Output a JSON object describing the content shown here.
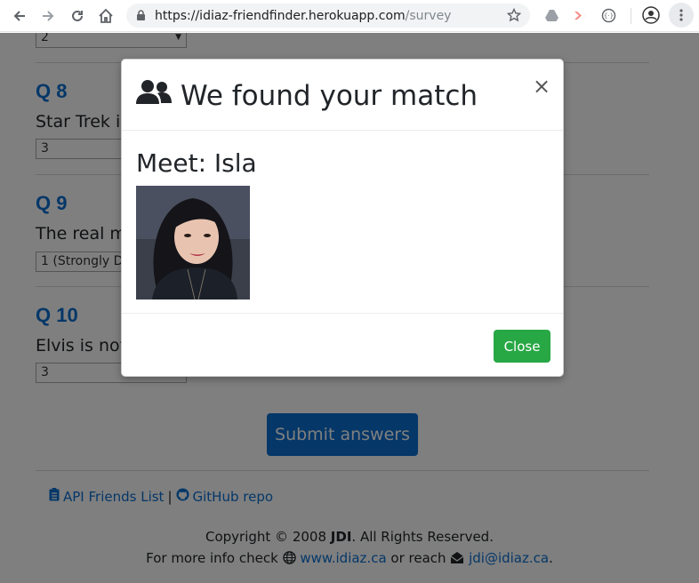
{
  "browser": {
    "url_host": "https://idiaz-friendfinder.herokuapp.com",
    "url_path": "/survey"
  },
  "survey": {
    "prev_select_value": "2",
    "questions": [
      {
        "label": "Q 8",
        "text": "Star Trek is",
        "value": "3"
      },
      {
        "label": "Q 9",
        "text": "The real m",
        "value": "1 (Strongly D"
      },
      {
        "label": "Q 10",
        "text": "Elvis is not",
        "value": "3"
      }
    ],
    "submit_label": "Submit answers"
  },
  "footer": {
    "api_link": "API Friends List",
    "separator": "|",
    "github_link": "GitHub repo",
    "copyright_prefix": "Copyright © 2008 ",
    "copyright_owner": "JDI",
    "copyright_suffix": ". All Rights Reserved.",
    "info_prefix": "For more info check ",
    "website": "www.idiaz.ca",
    "info_middle": " or reach ",
    "email": "jdi@idiaz.ca",
    "info_suffix": "."
  },
  "modal": {
    "title": "We found your match",
    "close_symbol": "×",
    "meet_text": "Meet: Isla",
    "close_button": "Close"
  },
  "colors": {
    "link_blue": "#0b6ed1",
    "success_green": "#28a745"
  }
}
